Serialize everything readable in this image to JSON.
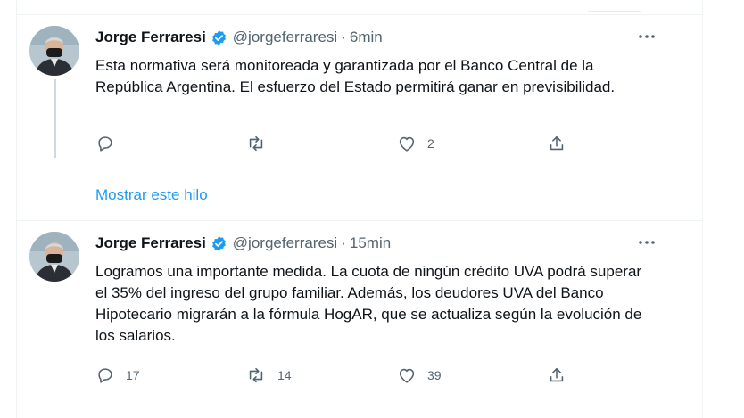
{
  "tweets": [
    {
      "author_name": "Jorge Ferraresi",
      "handle": "@jorgeferraresi",
      "separator": "·",
      "time": "6min",
      "text": "Esta normativa será monitoreada y garantizada por el Banco Central de la República Argentina. El esfuerzo del Estado permitirá ganar en previsibilidad.",
      "reply_count": "",
      "retweet_count": "",
      "like_count": "2",
      "show_thread": "Mostrar este hilo"
    },
    {
      "author_name": "Jorge Ferraresi",
      "handle": "@jorgeferraresi",
      "separator": "·",
      "time": "15min",
      "text": "Logramos una importante medida. La cuota de ningún crédito UVA podrá superar el 35% del ingreso del grupo familiar. Además, los deudores UVA del Banco Hipotecario migrarán a la fórmula HogAR, que se actualiza según la evolución de los salarios.",
      "reply_count": "17",
      "retweet_count": "14",
      "like_count": "39"
    }
  ],
  "colors": {
    "accent": "#1d9bf0",
    "secondary_text": "#536471",
    "border": "#eff3f4"
  },
  "icons": [
    "verified-badge-icon",
    "more-options-icon",
    "reply-icon",
    "retweet-icon",
    "like-icon",
    "share-icon"
  ]
}
